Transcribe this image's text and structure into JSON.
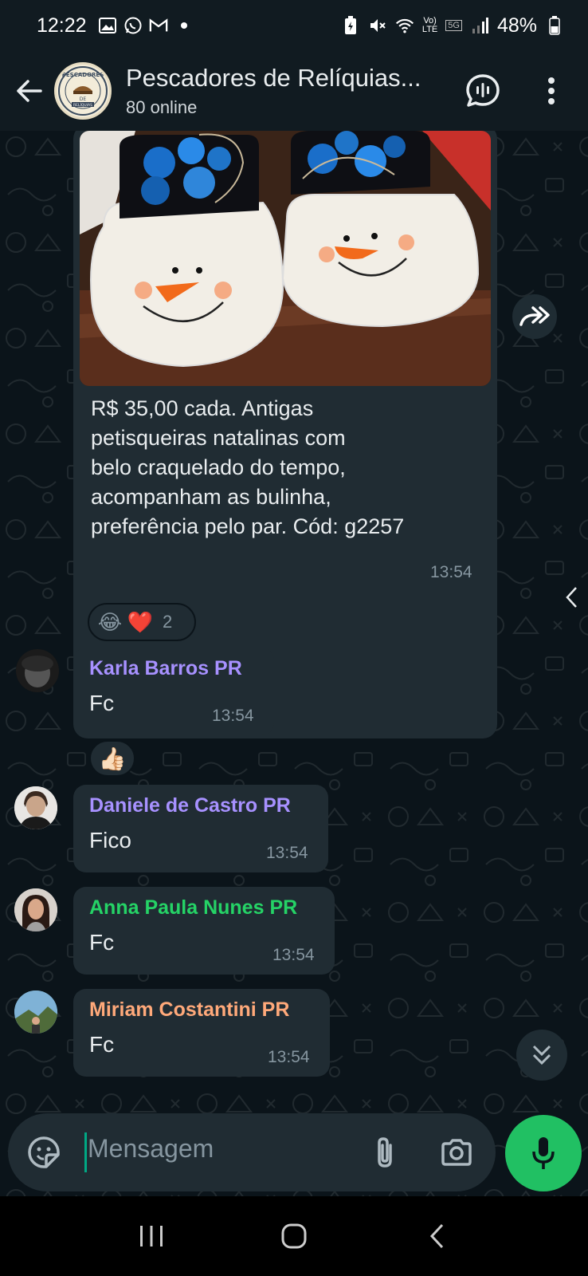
{
  "status_bar": {
    "time": "12:22",
    "battery": "48%",
    "left_icons": [
      "gallery-icon",
      "whatsapp-icon",
      "gmail-icon",
      "dot-icon"
    ],
    "right_icons": [
      "battery-saver-icon",
      "mute-icon",
      "wifi-icon",
      "volte-icon",
      "5g-icon",
      "signal-icon",
      "battery-icon"
    ]
  },
  "header": {
    "group_name": "Pescadores de Relíquias...",
    "subtitle": "80 online",
    "avatar_text_top": "PESCADORES",
    "avatar_text_mid": "DE",
    "avatar_text_bot": "RELÍQUIAS"
  },
  "messages": {
    "image_post": {
      "caption": "R$ 35,00 cada. Antigas petisqueiras natalinas com belo craquelado do tempo, acompanham as bulinha, preferência pelo par. Cód: g2257",
      "caption_lines": [
        "R$ 35,00 cada. Antigas",
        "petisqueiras natalinas com",
        "belo craquelado do tempo,",
        "acompanham as bulinha,",
        "preferência pelo par. Cód: g2257"
      ],
      "time": "13:54",
      "reactions": {
        "emojis": [
          "😂",
          "❤️"
        ],
        "count": "2"
      }
    },
    "replies": [
      {
        "sender": "Karla Barros PR",
        "text": "Fc",
        "time": "13:54",
        "color": "#a791ff",
        "reaction": "👍🏻"
      },
      {
        "sender": "Daniele de Castro PR",
        "text": "Fico",
        "time": "13:54",
        "color": "#a791ff"
      },
      {
        "sender": "Anna Paula Nunes PR",
        "text": "Fc",
        "time": "13:54",
        "color": "#25d366"
      },
      {
        "sender": "Miriam Costantini PR",
        "text": "Fc",
        "time": "13:54",
        "color": "#ffa97a"
      }
    ]
  },
  "composer": {
    "placeholder": "Mensagem"
  },
  "colors": {
    "background": "#0b141a",
    "bubble": "#202c33",
    "accent_green": "#21c063"
  }
}
